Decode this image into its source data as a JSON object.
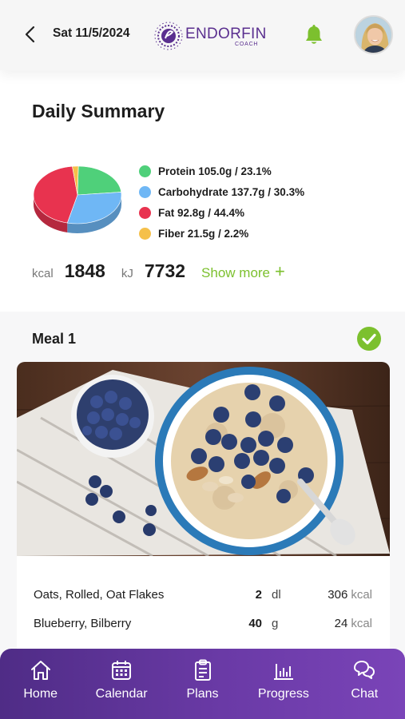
{
  "header": {
    "date": "Sat 11/5/2024",
    "logo_text": "ENDORFIN",
    "logo_subtext": "COACH"
  },
  "summary": {
    "title": "Daily Summary",
    "legend": [
      {
        "label": "Protein 105.0g / 23.1%",
        "color": "#4fd07a"
      },
      {
        "label": "Carbohydrate 137.7g / 30.3%",
        "color": "#6fb7f5"
      },
      {
        "label": "Fat 92.8g / 44.4%",
        "color": "#e8334f"
      },
      {
        "label": "Fiber 21.5g / 2.2%",
        "color": "#f5c04a"
      }
    ],
    "kcal_label": "kcal",
    "kcal_value": "1848",
    "kj_label": "kJ",
    "kj_value": "7732",
    "show_more": "Show more"
  },
  "chart_data": {
    "type": "pie",
    "categories": [
      "Protein",
      "Carbohydrate",
      "Fat",
      "Fiber"
    ],
    "values": [
      23.1,
      30.3,
      44.4,
      2.2
    ],
    "colors": [
      "#4fd07a",
      "#6fb7f5",
      "#e8334f",
      "#f5c04a"
    ]
  },
  "meal": {
    "title": "Meal 1",
    "completed": true,
    "items": [
      {
        "name": "Oats, Rolled, Oat Flakes",
        "qty": "2",
        "unit": "dl",
        "kcal": "306",
        "kcal_unit": "kcal"
      },
      {
        "name": "Blueberry, Bilberry",
        "qty": "40",
        "unit": "g",
        "kcal": "24",
        "kcal_unit": "kcal"
      }
    ]
  },
  "nav": {
    "items": [
      {
        "label": "Home",
        "icon": "home-icon"
      },
      {
        "label": "Calendar",
        "icon": "calendar-icon"
      },
      {
        "label": "Plans",
        "icon": "clipboard-icon"
      },
      {
        "label": "Progress",
        "icon": "bar-chart-icon"
      },
      {
        "label": "Chat",
        "icon": "chat-icon"
      }
    ]
  },
  "colors": {
    "brand_purple": "#5a2f8f",
    "accent_green": "#7cc02e",
    "nav_gradient_start": "#4f2c86",
    "nav_gradient_end": "#7a44b8"
  }
}
